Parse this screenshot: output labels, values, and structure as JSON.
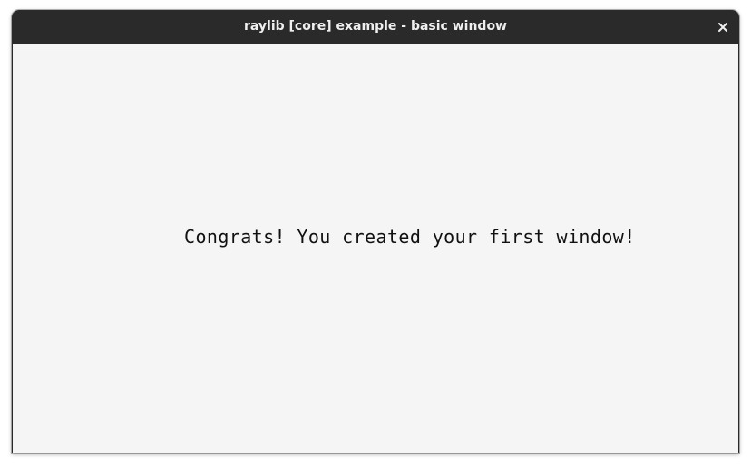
{
  "window": {
    "title": "raylib [core] example - basic window",
    "close_icon": "close-icon"
  },
  "canvas": {
    "message": "Congrats! You created your first window!",
    "background_color": "#f5f5f5",
    "text_color": "#111111"
  },
  "colors": {
    "titlebar": "#2a2a2a",
    "title_text": "#efefef"
  }
}
